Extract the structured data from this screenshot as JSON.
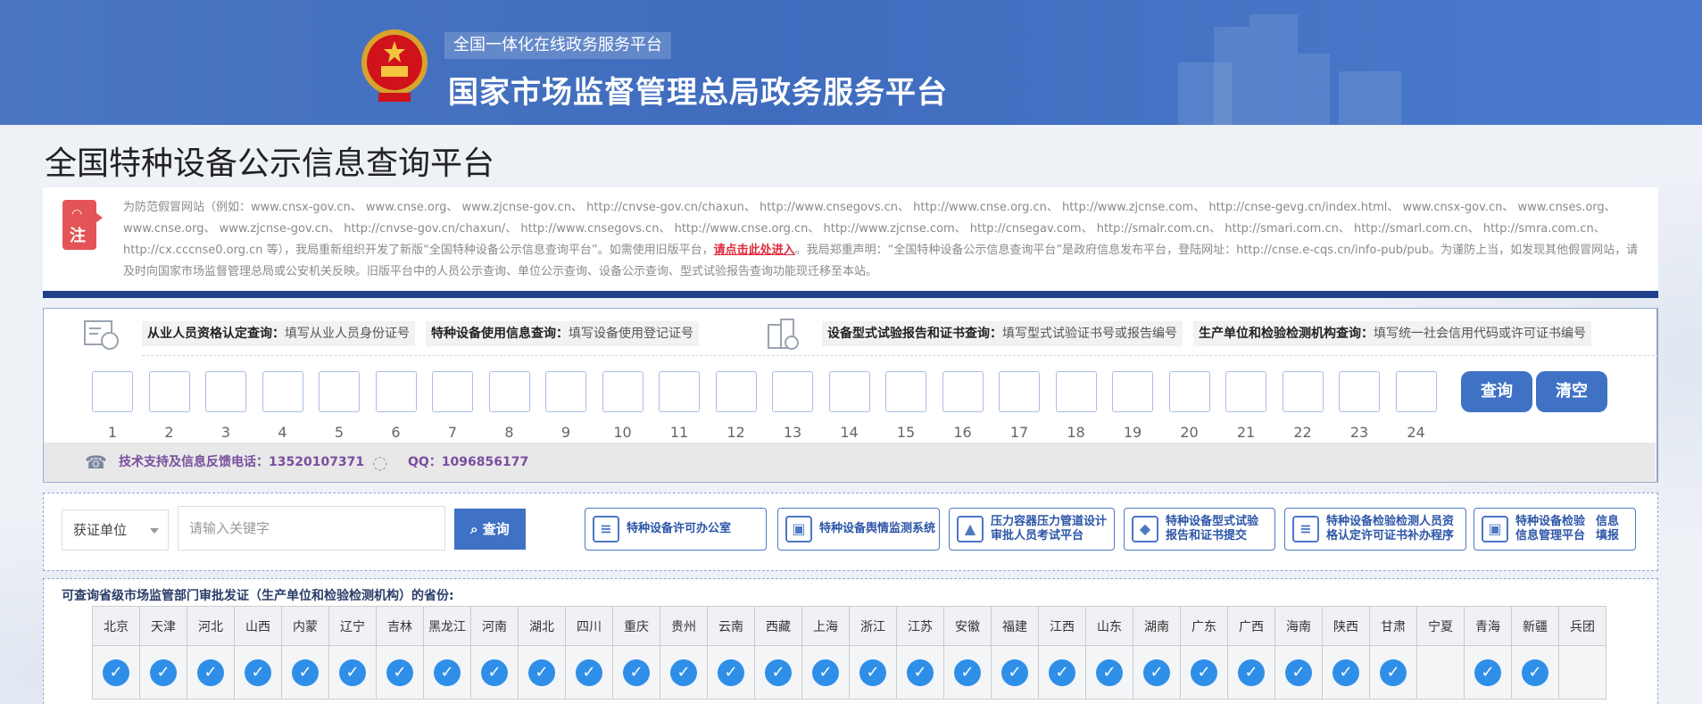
{
  "header": {
    "subtitle": "全国一体化在线政务服务平台",
    "title": "国家市场监督管理总局政务服务平台"
  },
  "page_title": "全国特种设备公示信息查询平台",
  "notice": {
    "badge": "注",
    "text_before": "为防范假冒网站（例如：www.cnsx-gov.cn、 www.cnse.org、 www.zjcnse-gov.cn、 http://cnvse-gov.cn/chaxun、 http://www.cnsegovs.cn、 http://www.cnse.org.cn、 http://www.zjcnse.com、 http://cnse-gevg.cn/index.html、 www.cnsx-gov.cn、 www.cnses.org、 www.cnse.org、 www.zjcnse-gov.cn、 http://cnvse-gov.cn/chaxun/、 http://www.cnsegovs.cn、 http://www.cnse.org.cn、 http://www.zjcnse.com、 http://cnsegav.com、 http://smalr.com.cn、 http://smari.com.cn、 http://smarl.com.cn、 http://smra.com.cn、 http://cx.cccnse0.org.cn 等），我局重新组织开发了新版“全国特种设备公示信息查询平台”。如需使用旧版平台，",
    "link": "请点击此处进入",
    "text_after": "。我局郑重声明：“全国特种设备公示信息查询平台”是政府信息发布平台，登陆网址：http://cnse.e-cqs.cn/info-pub/pub。为谨防上当，如发现其他假冒网站，请及时向国家市场监督管理总局或公安机关反映。旧版平台中的人员公示查询、单位公示查询、设备公示查询、型式试验报告查询功能现迁移至本站。"
  },
  "query": {
    "hints": [
      {
        "label": "从业人员资格认定查询：",
        "desc": "填写从业人员身份证号"
      },
      {
        "label": "特种设备使用信息查询：",
        "desc": "填写设备使用登记证号"
      },
      {
        "label": "设备型式试验报告和证书查询：",
        "desc": "填写型式试验证书号或报告编号"
      },
      {
        "label": "生产单位和检验检测机构查询：",
        "desc": "填写统一社会信用代码或许可证书编号"
      }
    ],
    "digits": [
      "1",
      "2",
      "3",
      "4",
      "5",
      "6",
      "7",
      "8",
      "9",
      "10",
      "11",
      "12",
      "13",
      "14",
      "15",
      "16",
      "17",
      "18",
      "19",
      "20",
      "21",
      "22",
      "23",
      "24"
    ],
    "query_button": "查询",
    "clear_button": "清空",
    "support_phone": "技术支持及信息反馈电话：13520107371",
    "support_qq": "QQ：1096856177"
  },
  "search": {
    "select_value": "获证单位",
    "keyword_placeholder": "请输入关键字",
    "button": "查询",
    "links": [
      {
        "label": "特种设备许可办公室",
        "icon": "list-icon"
      },
      {
        "label": "特种设备舆情监测系统",
        "icon": "picture-icon"
      },
      {
        "label": "压力容器压力管道设计审批人员考试平台",
        "icon": "compass-icon"
      },
      {
        "label": "特种设备型式试验报告和证书提交",
        "icon": "cube-icon"
      },
      {
        "label": "特种设备检验检测人员资格认定许可证书补办程序",
        "icon": "list-icon"
      },
      {
        "label": "特种设备检验信息管理平台",
        "extra": "信息填报",
        "icon": "picture-icon"
      }
    ]
  },
  "provinces": {
    "title": "可查询省级市场监管部门审批发证（生产单位和检验检测机构）的省份:",
    "items": [
      {
        "name": "北京",
        "ok": true
      },
      {
        "name": "天津",
        "ok": true
      },
      {
        "name": "河北",
        "ok": true
      },
      {
        "name": "山西",
        "ok": true
      },
      {
        "name": "内蒙",
        "ok": true
      },
      {
        "name": "辽宁",
        "ok": true
      },
      {
        "name": "吉林",
        "ok": true
      },
      {
        "name": "黑龙江",
        "ok": true
      },
      {
        "name": "河南",
        "ok": true
      },
      {
        "name": "湖北",
        "ok": true
      },
      {
        "name": "四川",
        "ok": true
      },
      {
        "name": "重庆",
        "ok": true
      },
      {
        "name": "贵州",
        "ok": true
      },
      {
        "name": "云南",
        "ok": true
      },
      {
        "name": "西藏",
        "ok": true
      },
      {
        "name": "上海",
        "ok": true
      },
      {
        "name": "浙江",
        "ok": true
      },
      {
        "name": "江苏",
        "ok": true
      },
      {
        "name": "安徽",
        "ok": true
      },
      {
        "name": "福建",
        "ok": true
      },
      {
        "name": "江西",
        "ok": true
      },
      {
        "name": "山东",
        "ok": true
      },
      {
        "name": "湖南",
        "ok": true
      },
      {
        "name": "广东",
        "ok": true
      },
      {
        "name": "广西",
        "ok": true
      },
      {
        "name": "海南",
        "ok": true
      },
      {
        "name": "陕西",
        "ok": true
      },
      {
        "name": "甘肃",
        "ok": true
      },
      {
        "name": "宁夏",
        "ok": false
      },
      {
        "name": "青海",
        "ok": true
      },
      {
        "name": "新疆",
        "ok": true
      },
      {
        "name": "兵团",
        "ok": false
      }
    ]
  }
}
